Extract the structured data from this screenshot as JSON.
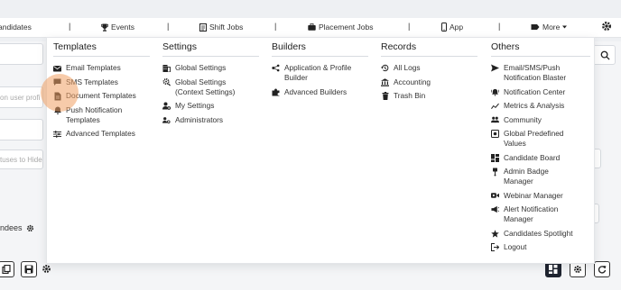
{
  "topnav": {
    "items": [
      {
        "label": "andidates",
        "icon": null
      },
      {
        "label": "Events",
        "icon": "trophy-icon"
      },
      {
        "label": "Shift Jobs",
        "icon": "list-icon"
      },
      {
        "label": "Placement Jobs",
        "icon": "briefcase-icon"
      },
      {
        "label": "App",
        "icon": "phone-icon"
      },
      {
        "label": "More",
        "icon": "tag-icon"
      }
    ]
  },
  "background": {
    "search_placeholder": "on user profi",
    "status_placeholder": "tuses to Hide",
    "attendees_label": "ndees"
  },
  "menu": {
    "columns": [
      {
        "title": "Templates",
        "items": [
          {
            "label": "Email Templates",
            "icon": "envelope-icon"
          },
          {
            "label": "SMS Templates",
            "icon": "sms-icon"
          },
          {
            "label": "Document Templates",
            "icon": "document-icon"
          },
          {
            "label": "Push Notification\nTemplates",
            "icon": "bell-icon"
          },
          {
            "label": "Advanced Templates",
            "icon": "sliders-icon"
          }
        ]
      },
      {
        "title": "Settings",
        "items": [
          {
            "label": "Global Settings",
            "icon": "building-icon"
          },
          {
            "label": "Global Settings\n(Context Settings)",
            "icon": "cog-search-icon"
          },
          {
            "label": "My Settings",
            "icon": "user-cog-icon"
          },
          {
            "label": "Administrators",
            "icon": "users-cog-icon"
          }
        ]
      },
      {
        "title": "Builders",
        "items": [
          {
            "label": "Application & Profile\nBuilder",
            "icon": "workflow-icon"
          },
          {
            "label": "Advanced Builders",
            "icon": "puzzle-icon"
          }
        ]
      },
      {
        "title": "Records",
        "items": [
          {
            "label": "All Logs",
            "icon": "history-icon"
          },
          {
            "label": "Accounting",
            "icon": "bank-icon"
          },
          {
            "label": "Trash Bin",
            "icon": "trash-icon"
          }
        ]
      },
      {
        "title": "Others",
        "items": [
          {
            "label": "Email/SMS/Push\nNotification Blaster",
            "icon": "send-icon"
          },
          {
            "label": "Notification Center",
            "icon": "bell-ring-icon"
          },
          {
            "label": "Metrics & Analysis",
            "icon": "chart-line-icon"
          },
          {
            "label": "Community",
            "icon": "people-icon"
          },
          {
            "label": "Global Predefined\nValues",
            "icon": "value-box-icon"
          },
          {
            "label": "Candidate Board",
            "icon": "dashboard-icon"
          },
          {
            "label": "Admin Badge\nManager",
            "icon": "badge-icon"
          },
          {
            "label": "Webinar Manager",
            "icon": "video-icon"
          },
          {
            "label": "Alert Notification\nManager",
            "icon": "megaphone-icon"
          },
          {
            "label": "Candidates Spotlight",
            "icon": "star-icon"
          },
          {
            "label": "Logout",
            "icon": "logout-icon"
          }
        ]
      }
    ]
  }
}
